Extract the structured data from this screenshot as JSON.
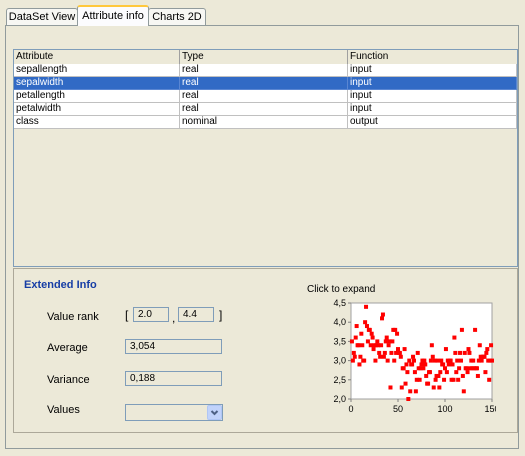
{
  "tabs": [
    {
      "label": "DataSet View"
    },
    {
      "label": "Attribute info"
    },
    {
      "label": "Charts 2D"
    }
  ],
  "table": {
    "columns": [
      "Attribute",
      "Type",
      "Function"
    ],
    "rows": [
      [
        "sepallength",
        "real",
        "input"
      ],
      [
        "sepalwidth",
        "real",
        "input"
      ],
      [
        "petallength",
        "real",
        "input"
      ],
      [
        "petalwidth",
        "real",
        "input"
      ],
      [
        "class",
        "nominal",
        "output"
      ]
    ],
    "selected_row": 1
  },
  "extended_info": {
    "title": "Extended Info",
    "value_rank_label": "Value rank",
    "rank_open": "[",
    "rank_min": "2.0",
    "rank_sep": ",",
    "rank_max": "4.4",
    "rank_close": "]",
    "average_label": "Average",
    "average_value": "3,054",
    "variance_label": "Variance",
    "variance_value": "0,188",
    "values_label": "Values",
    "values_selected": ""
  },
  "chart_caption": "Click to expand",
  "chart_data": {
    "type": "scatter",
    "title": "",
    "xlabel": "",
    "ylabel": "",
    "xlim": [
      0,
      150
    ],
    "ylim": [
      2.0,
      4.5
    ],
    "xticks": [
      "0",
      "50",
      "100",
      "150"
    ],
    "yticks": [
      "2,0",
      "2,5",
      "3,0",
      "3,5",
      "4,0",
      "4,5"
    ],
    "color": "#ff0000",
    "grid": false,
    "series": [
      {
        "x": [
          1,
          2,
          3,
          4,
          5,
          6,
          7,
          8,
          9,
          10,
          11,
          12,
          13,
          14,
          15,
          16,
          17,
          18,
          19,
          20,
          21,
          22,
          23,
          24,
          25,
          26,
          27,
          28,
          29,
          30,
          31,
          32,
          33,
          34,
          35,
          36,
          37,
          38,
          39,
          40,
          41,
          42,
          43,
          44,
          45,
          46,
          47,
          48,
          49,
          50,
          51,
          52,
          53,
          54,
          55,
          56,
          57,
          58,
          59,
          60,
          61,
          62,
          63,
          64,
          65,
          66,
          67,
          68,
          69,
          70,
          71,
          72,
          73,
          74,
          75,
          76,
          77,
          78,
          79,
          80,
          81,
          82,
          83,
          84,
          85,
          86,
          87,
          88,
          89,
          90,
          91,
          92,
          93,
          94,
          95,
          96,
          97,
          98,
          99,
          100,
          101,
          102,
          103,
          104,
          105,
          106,
          107,
          108,
          109,
          110,
          111,
          112,
          113,
          114,
          115,
          116,
          117,
          118,
          119,
          120,
          121,
          122,
          123,
          124,
          125,
          126,
          127,
          128,
          129,
          130,
          131,
          132,
          133,
          134,
          135,
          136,
          137,
          138,
          139,
          140,
          141,
          142,
          143,
          144,
          145,
          146,
          147,
          148,
          149,
          150
        ],
        "y": [
          3.5,
          3.0,
          3.2,
          3.1,
          3.6,
          3.9,
          3.4,
          3.4,
          2.9,
          3.1,
          3.7,
          3.4,
          3.0,
          3.0,
          4.0,
          4.4,
          3.9,
          3.5,
          3.8,
          3.8,
          3.4,
          3.7,
          3.6,
          3.3,
          3.4,
          3.0,
          3.4,
          3.5,
          3.4,
          3.2,
          3.1,
          3.4,
          4.1,
          4.2,
          3.1,
          3.2,
          3.5,
          3.6,
          3.0,
          3.4,
          3.5,
          2.3,
          3.2,
          3.5,
          3.8,
          3.0,
          3.8,
          3.2,
          3.7,
          3.3,
          3.2,
          3.2,
          3.1,
          2.3,
          2.8,
          2.8,
          3.3,
          2.4,
          2.9,
          2.7,
          2.0,
          3.0,
          2.2,
          2.9,
          2.9,
          3.1,
          3.0,
          2.7,
          2.2,
          2.5,
          3.2,
          2.8,
          2.5,
          2.8,
          2.9,
          3.0,
          2.8,
          3.0,
          2.9,
          2.6,
          2.4,
          2.4,
          2.7,
          2.7,
          3.0,
          3.4,
          3.1,
          2.3,
          3.0,
          2.5,
          2.6,
          3.0,
          2.6,
          2.3,
          2.7,
          3.0,
          2.9,
          2.9,
          2.5,
          2.8,
          3.3,
          2.7,
          3.0,
          2.9,
          3.0,
          3.0,
          2.5,
          2.9,
          2.5,
          3.6,
          3.2,
          2.7,
          3.0,
          2.5,
          2.8,
          3.2,
          3.0,
          3.8,
          2.6,
          2.2,
          3.2,
          2.8,
          2.8,
          2.7,
          3.3,
          3.2,
          2.8,
          3.0,
          2.8,
          3.0,
          2.8,
          3.8,
          2.8,
          2.8,
          2.6,
          3.0,
          3.4,
          3.1,
          3.0,
          3.1,
          3.1,
          3.1,
          2.7,
          3.2,
          3.3,
          3.0,
          2.5,
          3.0,
          3.4,
          3.0
        ]
      }
    ]
  }
}
